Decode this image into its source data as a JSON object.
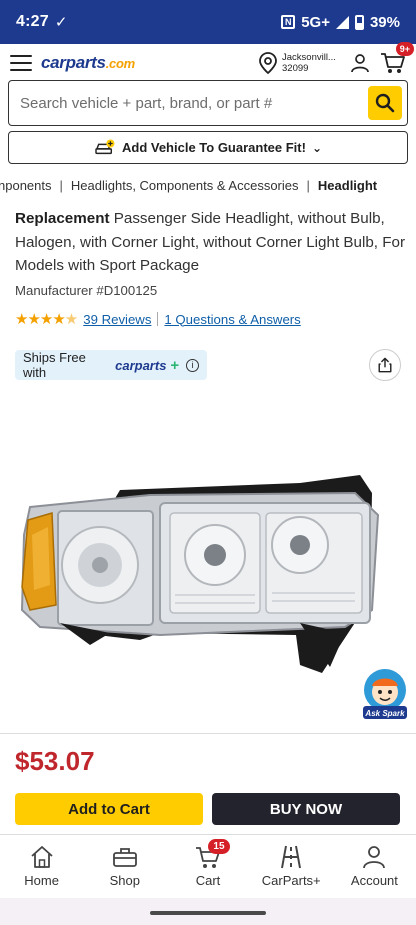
{
  "status_bar": {
    "time": "4:27",
    "network": "5G+",
    "battery": "39%"
  },
  "header": {
    "logo_main": "carparts",
    "logo_suffix": ".com",
    "location_city": "Jacksonvill...",
    "location_zip": "32099",
    "cart_badge": "9+"
  },
  "search": {
    "placeholder": "Search vehicle + part, brand, or part #"
  },
  "add_vehicle": {
    "label": "Add Vehicle To Guarantee Fit!"
  },
  "breadcrumb": [
    "nponents",
    "Headlights, Components & Accessories",
    "Headlight"
  ],
  "product": {
    "title_bold": "Replacement",
    "title_rest": " Passenger Side Headlight, without Bulb, Halogen, with Corner Light, without Corner Light Bulb, For Models with Sport Package",
    "manufacturer": "Manufacturer #D100125",
    "rating": 4.5,
    "reviews_link": "39 Reviews",
    "qa_link": "1 Questions & Answers",
    "ships_free_text": "Ships Free with",
    "ships_free_brand": "carparts",
    "price": "$53.07"
  },
  "ask_spark": {
    "label": "Ask Spark"
  },
  "actions": {
    "add_to_cart": "Add to Cart",
    "buy_now": "BUY NOW"
  },
  "bottom_nav": {
    "items": [
      {
        "label": "Home",
        "icon": "home-icon"
      },
      {
        "label": "Shop",
        "icon": "toolbox-icon"
      },
      {
        "label": "Cart",
        "icon": "cart-icon",
        "badge": "15"
      },
      {
        "label": "CarParts+",
        "icon": "road-icon"
      },
      {
        "label": "Account",
        "icon": "person-icon"
      }
    ]
  },
  "colors": {
    "brand_blue": "#1d3a8f",
    "accent_yellow": "#ffcc00",
    "price_red": "#c0272d",
    "link_blue": "#0f5fa8"
  }
}
